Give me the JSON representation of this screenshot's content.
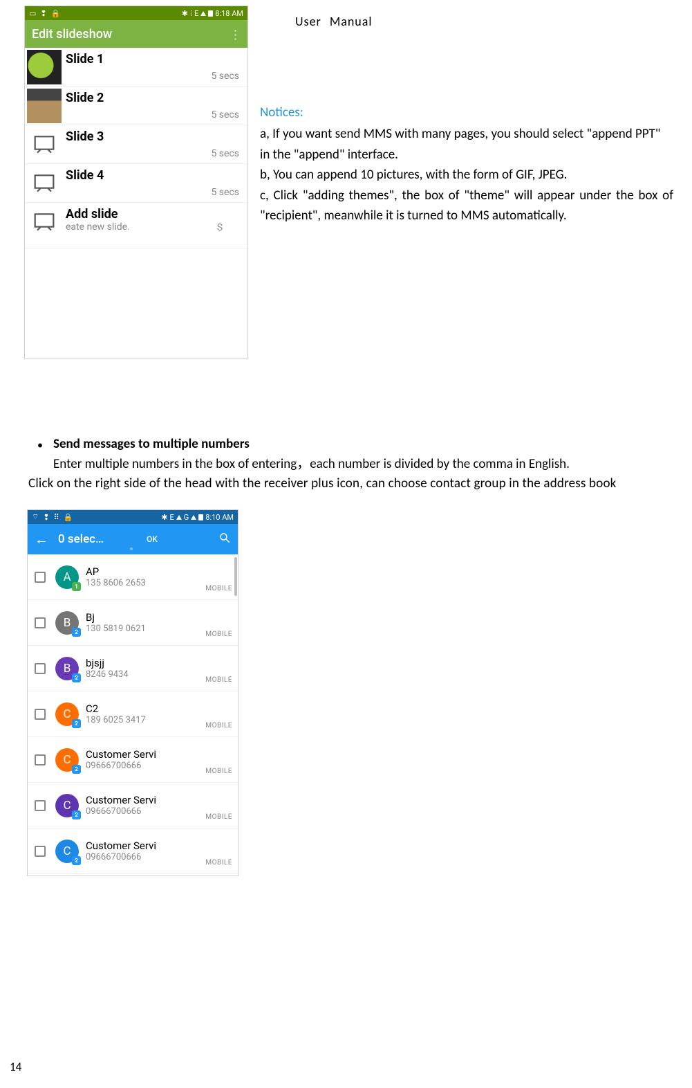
{
  "header": {
    "user": "User",
    "manual": "Manual"
  },
  "page_number": "14",
  "shot1": {
    "status": {
      "time": "8:18 AM",
      "net": "E"
    },
    "appbar_title": "Edit slideshow",
    "slides": [
      {
        "title": "Slide 1",
        "dur": "5 secs"
      },
      {
        "title": "Slide 2",
        "dur": "5 secs"
      },
      {
        "title": "Slide 3",
        "dur": "5 secs"
      },
      {
        "title": "Slide 4",
        "dur": "5 secs"
      }
    ],
    "add_title": "Add slide",
    "add_sub": "eate new slide.",
    "add_s": "S"
  },
  "notices": {
    "heading": "Notices:",
    "a": "a, If you want send MMS with many pages, you should select \"append PPT\" in the \"append\" interface.",
    "b": "b, You can append 10 pictures, with the form of GIF, JPEG.",
    "c": "c, Click \"adding themes\", the box of \"theme\" will appear under the box of \"recipient\", meanwhile it is turned to MMS automatically."
  },
  "section2": {
    "bullet": "Send messages to multiple numbers",
    "line1": "Enter multiple numbers in the box of entering，each number is divided by the comma in English.",
    "line2": "Click on the right side of the head with the receiver plus icon, can choose contact group in the address book"
  },
  "shot2": {
    "status": {
      "time": "8:10 AM",
      "net1": "E",
      "net2": "G"
    },
    "back": "←",
    "title": "0 selec…",
    "ok": "OK",
    "type_label": "MOBILE",
    "contacts": [
      {
        "letter": "A",
        "sim": "1",
        "av": "av-teal",
        "name": "AP",
        "num": "135 8606 2653"
      },
      {
        "letter": "B",
        "sim": "2",
        "av": "av-grey",
        "name": "Bj",
        "num": "130 5819 0621"
      },
      {
        "letter": "B",
        "sim": "2",
        "av": "av-purple",
        "name": "bjsjj",
        "num": "8246 9434"
      },
      {
        "letter": "C",
        "sim": "2",
        "av": "av-orange",
        "name": "C2",
        "num": "189 6025 3417"
      },
      {
        "letter": "C",
        "sim": "2",
        "av": "av-orange",
        "name": "Customer Servi",
        "num": "09666700666"
      },
      {
        "letter": "C",
        "sim": "2",
        "av": "av-deeppurple",
        "name": "Customer Servi",
        "num": "09666700666"
      },
      {
        "letter": "C",
        "sim": "2",
        "av": "av-blue",
        "name": "Customer Servi",
        "num": "09666700666"
      }
    ]
  }
}
